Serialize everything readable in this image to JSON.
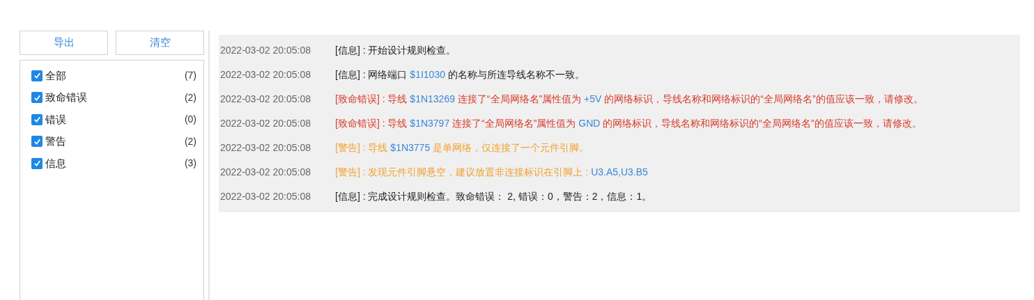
{
  "buttons": [
    {
      "label": "导出"
    },
    {
      "label": "清空"
    }
  ],
  "filters": [
    {
      "label": "全部",
      "count": "(7)",
      "checked": true
    },
    {
      "label": "致命错误",
      "count": "(2)",
      "checked": true
    },
    {
      "label": "错误",
      "count": "(0)",
      "checked": true
    },
    {
      "label": "警告",
      "count": "(2)",
      "checked": true
    },
    {
      "label": "信息",
      "count": "(3)",
      "checked": true
    }
  ],
  "log": [
    {
      "time": "2022-03-02 20:05:08",
      "kind": "info",
      "tag": "[信息]",
      "segments": [
        {
          "kind": "text",
          "text": " : 开始设计规则检查。"
        }
      ]
    },
    {
      "time": "2022-03-02 20:05:08",
      "kind": "info",
      "tag": "[信息]",
      "segments": [
        {
          "kind": "text",
          "text": " : 网络端口 "
        },
        {
          "kind": "ref",
          "text": "$1I1030"
        },
        {
          "kind": "text",
          "text": " 的名称与所连导线名称不一致。"
        }
      ]
    },
    {
      "time": "2022-03-02 20:05:08",
      "kind": "fatal",
      "tag": "[致命错误]",
      "segments": [
        {
          "kind": "text",
          "text": " : 导线 "
        },
        {
          "kind": "ref",
          "text": "$1N13269"
        },
        {
          "kind": "text",
          "text": " 连接了“全局网络名”属性值为 "
        },
        {
          "kind": "ref",
          "text": "+5V"
        },
        {
          "kind": "text",
          "text": " 的网络标识，导线名称和网络标识的“全局网络名”的值应该一致，请修改。"
        }
      ]
    },
    {
      "time": "2022-03-02 20:05:08",
      "kind": "fatal",
      "tag": "[致命错误]",
      "segments": [
        {
          "kind": "text",
          "text": " : 导线 "
        },
        {
          "kind": "ref",
          "text": "$1N3797"
        },
        {
          "kind": "text",
          "text": " 连接了“全局网络名”属性值为 "
        },
        {
          "kind": "ref",
          "text": "GND"
        },
        {
          "kind": "text",
          "text": " 的网络标识，导线名称和网络标识的“全局网络名”的值应该一致，请修改。"
        }
      ]
    },
    {
      "time": "2022-03-02 20:05:08",
      "kind": "warning",
      "tag": "[警告]",
      "segments": [
        {
          "kind": "text",
          "text": " : 导线 "
        },
        {
          "kind": "ref",
          "text": "$1N3775"
        },
        {
          "kind": "text",
          "text": " 是单网络，仅连接了一个元件引脚。"
        }
      ]
    },
    {
      "time": "2022-03-02 20:05:08",
      "kind": "warning",
      "tag": "[警告]",
      "segments": [
        {
          "kind": "text",
          "text": " : 发现元件引脚悬空，建议放置非连接标识在引脚上 : "
        },
        {
          "kind": "ref",
          "text": "U3.A5,U3.B5"
        }
      ]
    },
    {
      "time": "2022-03-02 20:05:08",
      "kind": "info",
      "tag": "[信息]",
      "segments": [
        {
          "kind": "text",
          "text": " : 完成设计规则检查。致命错误： 2, 错误：0，警告：2，信息：1。"
        }
      ]
    }
  ]
}
